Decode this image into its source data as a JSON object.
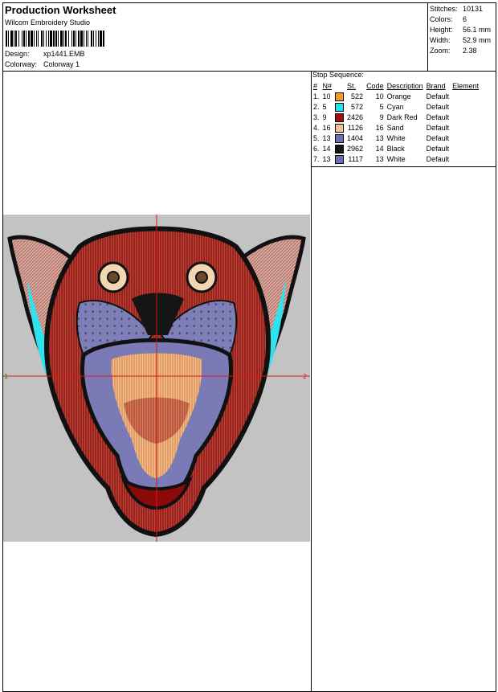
{
  "header": {
    "title": "Production Worksheet",
    "software": "Wilcom Embroidery Studio",
    "design_label": "Design:",
    "design_value": "xp1441.EMB",
    "colorway_label": "Colorway:",
    "colorway_value": "Colorway 1"
  },
  "stats": [
    {
      "label": "Stitches:",
      "value": "10131"
    },
    {
      "label": "Colors:",
      "value": "6"
    },
    {
      "label": "Height:",
      "value": "56.1 mm"
    },
    {
      "label": "Width:",
      "value": "52.9 mm"
    },
    {
      "label": "Zoom:",
      "value": "2.38"
    }
  ],
  "stop_sequence": {
    "title": "Stop Sequence:",
    "headers": {
      "num": "#",
      "needle": "N#",
      "st": "St.",
      "code": "Code",
      "desc": "Description",
      "brand": "Brand",
      "element": "Element"
    },
    "rows": [
      {
        "num": "1.",
        "needle": "10",
        "color": "#f39a2b",
        "st": "522",
        "code": "10",
        "desc": "Orange",
        "brand": "Default"
      },
      {
        "num": "2.",
        "needle": "5",
        "color": "#1ee6f0",
        "st": "572",
        "code": "5",
        "desc": "Cyan",
        "brand": "Default"
      },
      {
        "num": "3.",
        "needle": "9",
        "color": "#a01010",
        "st": "2426",
        "code": "9",
        "desc": "Dark Red",
        "brand": "Default"
      },
      {
        "num": "4.",
        "needle": "16",
        "color": "#f6c38e",
        "st": "1126",
        "code": "16",
        "desc": "Sand",
        "brand": "Default"
      },
      {
        "num": "5.",
        "needle": "13",
        "color": "#6e6eb2",
        "st": "1404",
        "code": "13",
        "desc": "White",
        "brand": "Default"
      },
      {
        "num": "6.",
        "needle": "14",
        "color": "#151515",
        "st": "2962",
        "code": "14",
        "desc": "Black",
        "brand": "Default"
      },
      {
        "num": "7.",
        "needle": "13",
        "color": "#6e6eb2",
        "st": "1117",
        "code": "13",
        "desc": "White",
        "brand": "Default"
      }
    ]
  },
  "preview": {
    "left_marker": "1",
    "right_marker": "2",
    "background_color": "#c3c3c3"
  }
}
